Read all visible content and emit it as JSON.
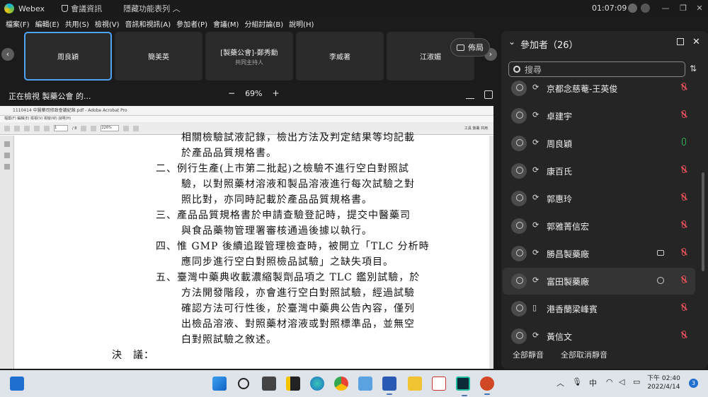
{
  "titlebar": {
    "app": "Webex",
    "meeting_info": "會議資訊",
    "hidden_features": "隱藏功能表列",
    "time": "01:07:09"
  },
  "menu": [
    "檔案(F)",
    "編輯(E)",
    "共用(S)",
    "檢視(V)",
    "音訊和視訊(A)",
    "參加者(P)",
    "會議(M)",
    "分組討論(B)",
    "說明(H)"
  ],
  "tiles": [
    {
      "name": "周良穎",
      "sub": ""
    },
    {
      "name": "簡美英",
      "sub": ""
    },
    {
      "name": "[製藥公會]-鄭秀勳",
      "sub": "共同主持人"
    },
    {
      "name": "李威著",
      "sub": ""
    },
    {
      "name": "江淑媚",
      "sub": ""
    }
  ],
  "layout_label": "佈局",
  "viewbar": {
    "viewing": "正在檢視 製藥公會 的...",
    "minus": "−",
    "zoom": "69%",
    "plus": "+"
  },
  "acrobat": {
    "title": "1110414 中醫藥司修政會議紀錄.pdf - Adobe Acrobat Pro",
    "menu": "檔案(F)  編輯(E)  檢視(V)  視窗(W)  說明(H)",
    "page": "1",
    "pages": "/ 8",
    "zoom": "226%",
    "right": "工具   簽署   共用"
  },
  "document": {
    "lines": [
      "相關檢驗試液記錄，檢出方法及判定結果等均記載",
      "於產品品質規格書。",
      "二、例行生產(上市第二批起)之檢驗不進行空白對照試",
      "驗，以對照藥材溶液和製品溶液進行每次試驗之對",
      "照比對，亦同時記載於產品品質規格書。",
      "三、產品品質規格書於申請查驗登記時，提交中醫藥司",
      "與食品藥物管理署審核通過後據以執行。",
      "四、惟 GMP 後續追蹤管理檢查時，被開立「TLC 分析時",
      "應同步進行空白對照檢品試驗」之缺失項目。",
      "五、臺灣中藥典收載濃縮製劑品項之 TLC 鑑別試驗，於",
      "方法開發階段，亦會進行空白對照試驗，經過試驗",
      "確認方法可行性後，於臺灣中藥典公告內容，僅列",
      "出檢品溶液、對照藥材溶液或對照標準品，並無空",
      "白對照試驗之敘述。",
      "決　議："
    ]
  },
  "panel": {
    "title": "參加者",
    "count": "（26）",
    "search_placeholder": "搜尋",
    "participants": [
      {
        "name": "京都念慈菴-王英俊",
        "mic": "muted",
        "extra": ""
      },
      {
        "name": "卓建宇",
        "mic": "muted",
        "extra": ""
      },
      {
        "name": "周良穎",
        "mic": "on",
        "extra": ""
      },
      {
        "name": "康百氏",
        "mic": "muted",
        "extra": ""
      },
      {
        "name": "郭惠玲",
        "mic": "muted",
        "extra": ""
      },
      {
        "name": "郭雅菁信宏",
        "mic": "muted",
        "extra": ""
      },
      {
        "name": "勝昌製藥廠",
        "mic": "muted",
        "extra": "camera"
      },
      {
        "name": "富田製藥廠",
        "mic": "muted",
        "extra": "chat"
      },
      {
        "name": "港香蘭梁峰賓",
        "mic": "muted",
        "extra": ""
      },
      {
        "name": "黃信文",
        "mic": "muted",
        "extra": ""
      }
    ],
    "mute_all": "全部靜音",
    "unmute_all": "全部取消靜音"
  },
  "taskbar": {
    "ime": "中",
    "time": "下午 02:40",
    "date": "2022/4/14",
    "notifications": "3"
  },
  "colors": {
    "accent": "#4fa3f7",
    "muted": "#e0505a",
    "unmuted": "#2fb35a"
  }
}
